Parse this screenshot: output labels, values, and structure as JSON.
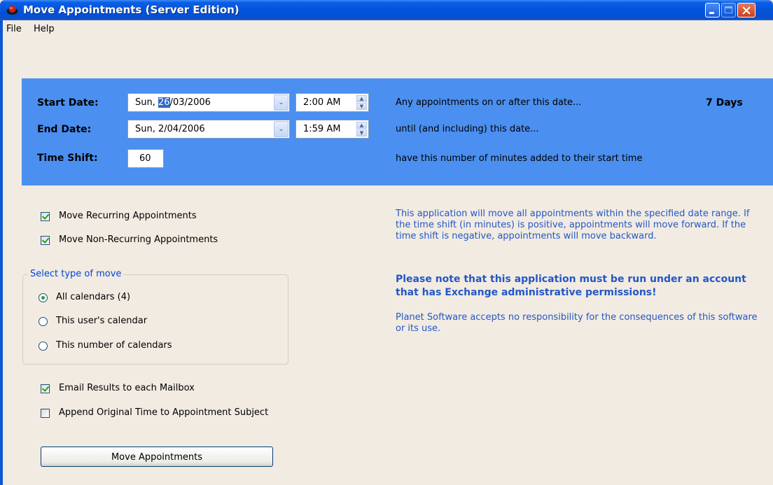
{
  "window": {
    "title": "Move Appointments (Server Edition)"
  },
  "menu": {
    "file": "File",
    "help": "Help"
  },
  "dates": {
    "start_label": "Start Date:",
    "start_day": "Sun,",
    "start_day_num": "26",
    "start_rest": "/03/2006",
    "start_time": "2:00 AM",
    "end_label": "End Date:",
    "end_date": "Sun,  2/04/2006",
    "end_time": "1:59 AM",
    "shift_label": "Time Shift:",
    "shift_value": "60",
    "start_desc": "Any appointments on or after this date...",
    "end_desc": "until (and including) this date...",
    "shift_desc": "have this number of minutes added to their start time",
    "days": "7 Days"
  },
  "options": {
    "recurring": {
      "label": "Move Recurring Appointments",
      "checked": true
    },
    "non_recurring": {
      "label": "Move Non-Recurring Appointments",
      "checked": true
    },
    "email_results": {
      "label": "Email Results to each Mailbox",
      "checked": true
    },
    "append_time": {
      "label": "Append Original Time to Appointment Subject",
      "checked": false
    }
  },
  "move_type": {
    "legend": "Select type of move",
    "options": [
      {
        "label": "All calendars (4)",
        "selected": true
      },
      {
        "label": "This user's calendar",
        "selected": false
      },
      {
        "label": "This number of calendars",
        "selected": false
      }
    ]
  },
  "info": {
    "description": "This application will move all appointments within the specified date range.  If the time shift (in minutes) is positive, appointments will move forward. If the time shift is negative, appointments will move backward.",
    "warning": "Please note that this application must be run under an account that has Exchange administrative permissions!",
    "disclaimer": "Planet Software accepts no responsibility for the consequences of this software or its use."
  },
  "actions": {
    "move_button": "Move Appointments"
  },
  "colors": {
    "panel_blue": "#4b8ff0",
    "info_text": "#2457c5",
    "background": "#f1ebe2"
  }
}
